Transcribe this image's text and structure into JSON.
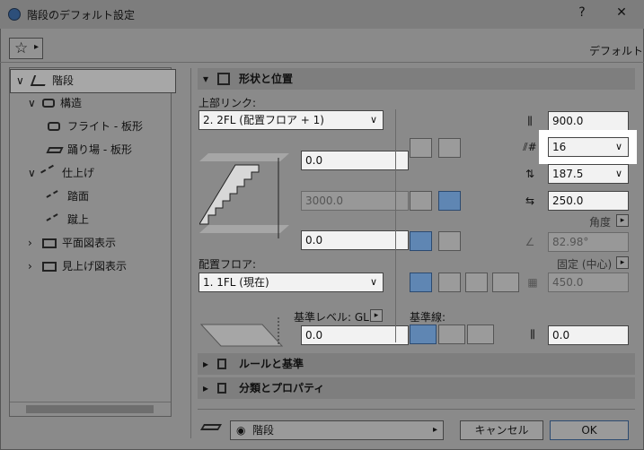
{
  "window": {
    "title": "階段のデフォルト設定",
    "help": "?",
    "close": "✕"
  },
  "toolbar": {
    "star": "☆",
    "arrow": "▸",
    "default_label": "デフォルト"
  },
  "tree": {
    "items": [
      {
        "label": "階段",
        "chev": "∨"
      },
      {
        "label": "構造",
        "chev": "∨"
      },
      {
        "label": "フライト - 板形"
      },
      {
        "label": "踊り場 - 板形"
      },
      {
        "label": "仕上げ",
        "chev": "∨"
      },
      {
        "label": "踏面"
      },
      {
        "label": "蹴上"
      },
      {
        "label": "平面図表示",
        "chev": "›"
      },
      {
        "label": "見上げ図表示",
        "chev": "›"
      }
    ]
  },
  "section_shape": {
    "label": "形状と位置",
    "toggle": "▾"
  },
  "upper_link": {
    "label": "上部リンク:",
    "value": "2. 2FL (配置フロア + 1)"
  },
  "top_offset": "0.0",
  "height": "3000.0",
  "bottom_offset": "0.0",
  "place_floor": {
    "label": "配置フロア:",
    "value": "1. 1FL (現在)"
  },
  "ref_level": {
    "label": "基準レベル: GL",
    "value": "0.0"
  },
  "width": "900.0",
  "risers": {
    "value": "16"
  },
  "riser_height": "187.5",
  "tread_depth": "250.0",
  "angle_label": "角度",
  "angle_value": "82.98°",
  "fixed_label": "固定 (中心)",
  "fixed_value": "450.0",
  "baseline": {
    "label": "基準線:",
    "value": "0.0"
  },
  "sections": [
    {
      "label": "ルールと基準",
      "toggle": "▸"
    },
    {
      "label": "分類とプロパティ",
      "toggle": "▸"
    }
  ],
  "footer": {
    "layer": "階段",
    "cancel": "キャンセル",
    "ok": "OK"
  }
}
